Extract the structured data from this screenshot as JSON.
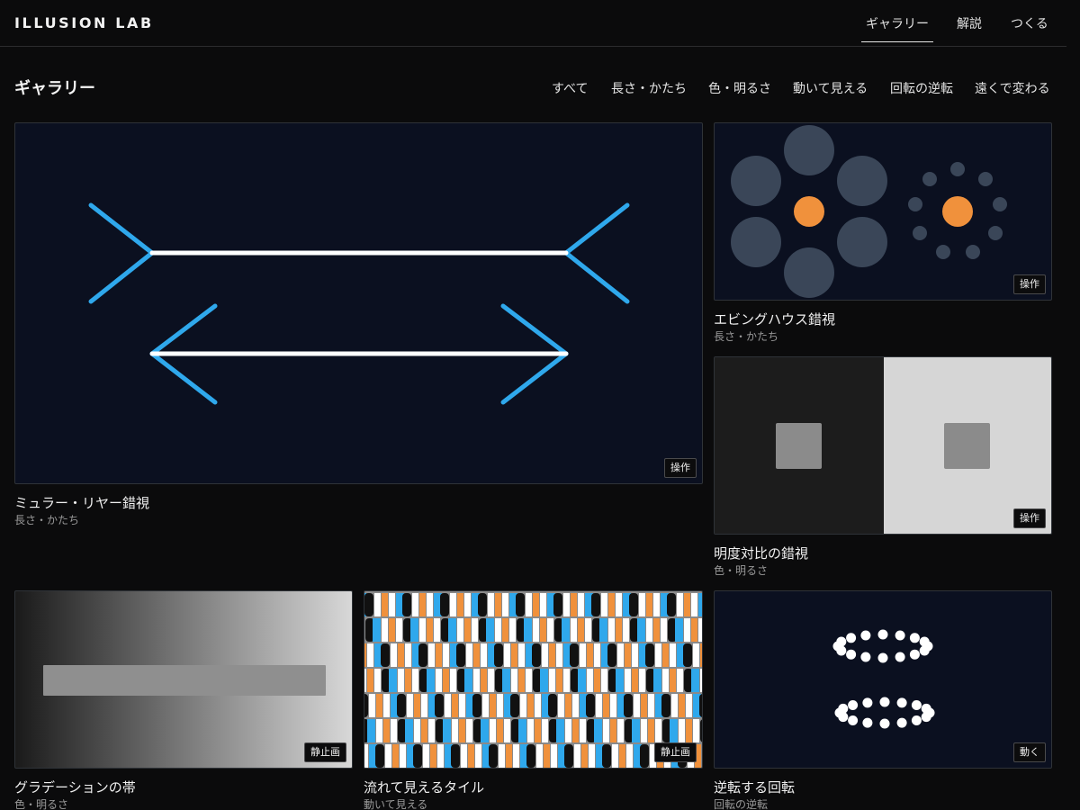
{
  "header": {
    "brand": "ILLUSION LAB",
    "nav": [
      {
        "label": "ギャラリー",
        "active": true
      },
      {
        "label": "解説",
        "active": false
      },
      {
        "label": "つくる",
        "active": false
      }
    ]
  },
  "gallery": {
    "title": "ギャラリー",
    "filters": [
      "すべて",
      "長さ・かたち",
      "色・明るさ",
      "動いて見える",
      "回転の逆転",
      "遠くで変わる"
    ]
  },
  "cards": [
    {
      "title": "ミュラー・リヤー錯視",
      "category": "長さ・かたち",
      "badge": "操作"
    },
    {
      "title": "エビングハウス錯視",
      "category": "長さ・かたち",
      "badge": "操作"
    },
    {
      "title": "明度対比の錯視",
      "category": "色・明るさ",
      "badge": "操作"
    },
    {
      "title": "グラデーションの帯",
      "category": "色・明るさ",
      "badge": "静止画"
    },
    {
      "title": "流れて見えるタイル",
      "category": "動いて見える",
      "badge": "静止画"
    },
    {
      "title": "逆転する回転",
      "category": "回転の逆転",
      "badge": "動く"
    }
  ],
  "colors": {
    "page_bg": "#0b0b0c",
    "thumb_bg": "#0b1020",
    "accent_blue": "#2fa8ec",
    "accent_orange": "#f0913c",
    "circle_grey": "#3a4658"
  }
}
